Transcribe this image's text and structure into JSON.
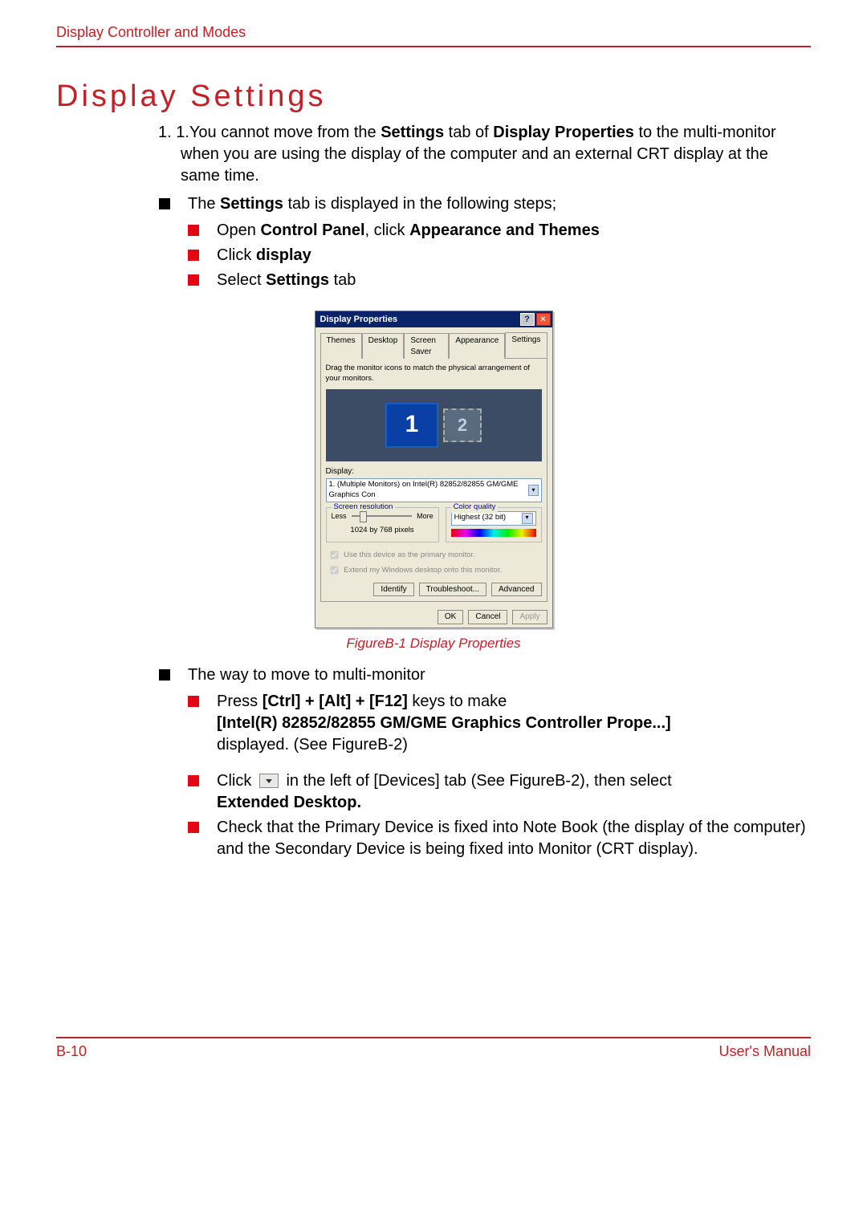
{
  "header": {
    "chapter": "Display Controller and Modes"
  },
  "title": "Display Settings",
  "list": {
    "item1_prefix": "1.",
    "item1": "1.You cannot move from the Settings tab of Display Properties to the multi-monitor when you are using the display of the computer and an external CRT display at the same time.",
    "bullet_settings_tab": "The Settings tab is displayed in the following steps;",
    "sub_open": "Open Control Panel, click Appearance and Themes",
    "sub_click_display": "Click display",
    "sub_select_settings": "Select Settings tab",
    "bullet_move_multi": "The way to move to multi-monitor",
    "sub_press_keys_a": "Press ",
    "sub_press_keys_b": " keys to make",
    "keys": "[Ctrl] + [Alt] + [F12]",
    "intel_line": "[Intel(R) 82852/82855 GM/GME Graphics Controller Prope...]",
    "displayed_line": "displayed. (See FigureB-2)",
    "click_line_a": "Click ",
    "click_line_b": " in the left of [Devices] tab (See FigureB-2), then select",
    "extended_desktop": "Extended Desktop.",
    "check_primary": "Check that the Primary Device is fixed into Note Book (the display of the computer) and the Secondary Device is being fixed into Monitor (CRT display)."
  },
  "figure": {
    "caption": "FigureB-1 Display Properties",
    "title": "Display Properties",
    "tabs": [
      "Themes",
      "Desktop",
      "Screen Saver",
      "Appearance",
      "Settings"
    ],
    "hint": "Drag the monitor icons to match the physical arrangement of your monitors.",
    "monitor1": "1",
    "monitor2": "2",
    "display_label": "Display:",
    "display_value": "1. (Multiple Monitors) on Intel(R) 82852/82855 GM/GME Graphics Con",
    "res_label": "Screen resolution",
    "less": "Less",
    "more": "More",
    "res_value": "1024 by 768 pixels",
    "color_label": "Color quality",
    "color_value": "Highest (32 bit)",
    "chk1": "Use this device as the primary monitor.",
    "chk2": "Extend my Windows desktop onto this monitor.",
    "btn_identify": "Identify",
    "btn_troubleshoot": "Troubleshoot...",
    "btn_advanced": "Advanced",
    "btn_ok": "OK",
    "btn_cancel": "Cancel",
    "btn_apply": "Apply"
  },
  "footer": {
    "page": "B-10",
    "right": "User's Manual"
  }
}
